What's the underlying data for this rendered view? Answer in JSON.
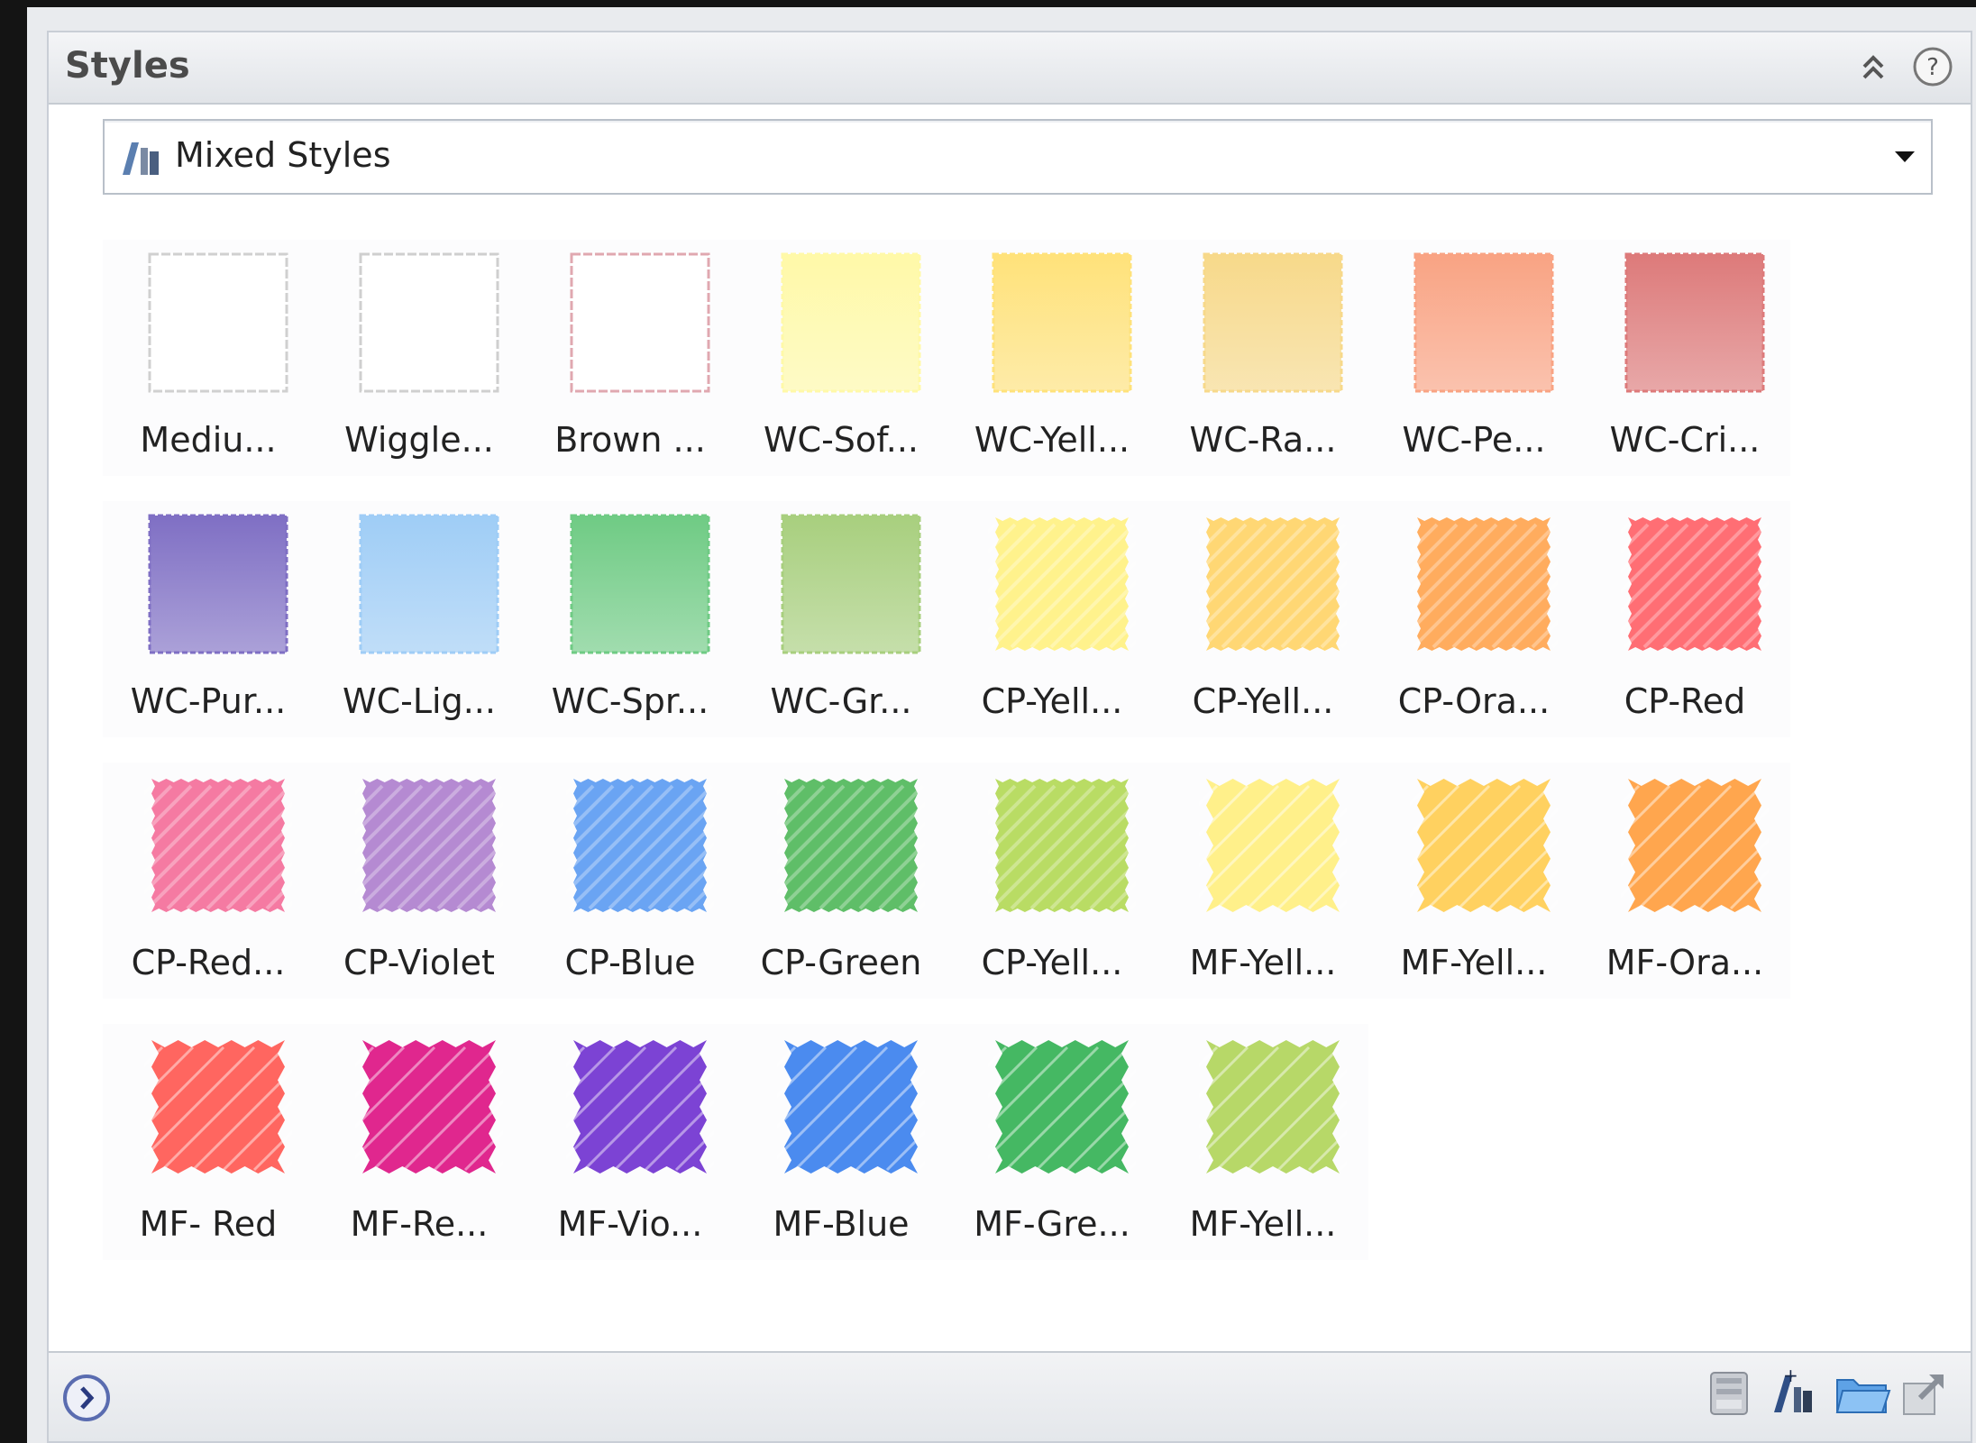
{
  "panel": {
    "title": "Styles",
    "collapse_icon": "double-chevron-up-icon",
    "help_icon": "help-icon"
  },
  "dropdown": {
    "value": "Mixed Styles",
    "icon": "styles-icon"
  },
  "styles": [
    {
      "label": "Mediu...",
      "color": "#ffffff",
      "kind": "outline",
      "border": "#d0d0d0"
    },
    {
      "label": "Wiggle...",
      "color": "#ffffff",
      "kind": "outline",
      "border": "#cfcfcf"
    },
    {
      "label": "Brown ...",
      "color": "#ffffff",
      "kind": "outline",
      "border": "#e0a8b0"
    },
    {
      "label": "WC-Sof...",
      "color": "#fff9a8",
      "kind": "wc"
    },
    {
      "label": "WC-Yell...",
      "color": "#ffe27a",
      "kind": "wc"
    },
    {
      "label": "WC-Ra...",
      "color": "#f7d98a",
      "kind": "wc"
    },
    {
      "label": "WC-Pe...",
      "color": "#f9a383",
      "kind": "wc"
    },
    {
      "label": "WC-Cri...",
      "color": "#dd7a7a",
      "kind": "wc"
    },
    {
      "label": "WC-Pur...",
      "color": "#7f6fc4",
      "kind": "wc"
    },
    {
      "label": "WC-Lig...",
      "color": "#9fcdf6",
      "kind": "wc"
    },
    {
      "label": "WC-Spr...",
      "color": "#6fcb84",
      "kind": "wc"
    },
    {
      "label": "WC-Gr...",
      "color": "#a8cf7e",
      "kind": "wc"
    },
    {
      "label": "CP-Yell...",
      "color": "#fff28c",
      "kind": "cp"
    },
    {
      "label": "CP-Yell...",
      "color": "#ffd774",
      "kind": "cp"
    },
    {
      "label": "CP-Ora...",
      "color": "#ffac5e",
      "kind": "cp"
    },
    {
      "label": "CP-Red",
      "color": "#ff6e74",
      "kind": "cp"
    },
    {
      "label": "CP-Red...",
      "color": "#f57aa2",
      "kind": "cp"
    },
    {
      "label": "CP-Violet",
      "color": "#b58ad2",
      "kind": "cp"
    },
    {
      "label": "CP-Blue",
      "color": "#6aa4f3",
      "kind": "cp"
    },
    {
      "label": "CP-Green",
      "color": "#5fbe68",
      "kind": "cp"
    },
    {
      "label": "CP-Yell...",
      "color": "#b9dc64",
      "kind": "cp"
    },
    {
      "label": "MF-Yell...",
      "color": "#fff08a",
      "kind": "mf"
    },
    {
      "label": "MF-Yell...",
      "color": "#ffd160",
      "kind": "mf"
    },
    {
      "label": "MF-Ora...",
      "color": "#ffa64e",
      "kind": "mf"
    },
    {
      "label": "MF- Red",
      "color": "#ff6660",
      "kind": "mf"
    },
    {
      "label": "MF-Re...",
      "color": "#e0278e",
      "kind": "mf"
    },
    {
      "label": "MF-Vio...",
      "color": "#7c43d4",
      "kind": "mf"
    },
    {
      "label": "MF-Blue",
      "color": "#4b8bef",
      "kind": "mf"
    },
    {
      "label": "MF-Gre...",
      "color": "#45b863",
      "kind": "mf"
    },
    {
      "label": "MF-Yell...",
      "color": "#b7d868",
      "kind": "mf"
    }
  ],
  "bottombar": {
    "expand_icon": "chevron-right-circle-icon",
    "buttons": [
      {
        "icon": "save-style-icon"
      },
      {
        "icon": "new-style-icon"
      },
      {
        "icon": "open-folder-icon"
      },
      {
        "icon": "export-icon"
      }
    ]
  }
}
